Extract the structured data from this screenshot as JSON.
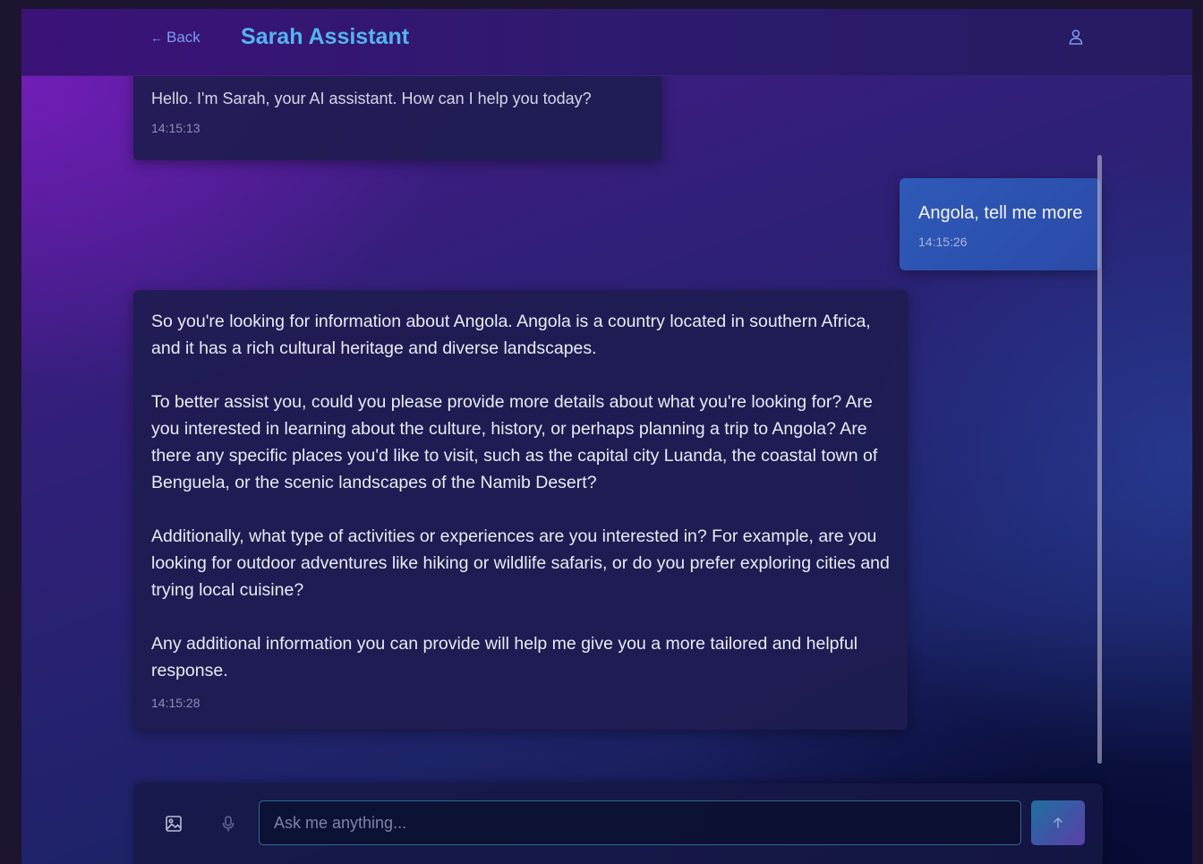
{
  "header": {
    "back_label": "Back",
    "back_arrow": "←",
    "title": "Sarah Assistant",
    "user_icon": "user-icon"
  },
  "messages": [
    {
      "role": "assistant",
      "text": "Hello. I'm Sarah, your AI assistant. How can I help you today?",
      "time": "14:15:13"
    },
    {
      "role": "user",
      "text": "Angola, tell me more",
      "time": "14:15:26"
    },
    {
      "role": "assistant",
      "paragraphs": [
        "So you're looking for information about Angola. Angola is a country located in southern Africa, and it has a rich cultural heritage and diverse landscapes.",
        "To better assist you, could you please provide more details about what you're looking for? Are you interested in learning about the culture, history, or perhaps planning a trip to Angola? Are there any specific places you'd like to visit, such as the capital city Luanda, the coastal town of Benguela, or the scenic landscapes of the Namib Desert?",
        "Additionally, what type of activities or experiences are you interested in? For example, are you looking for outdoor adventures like hiking or wildlife safaris, or do you prefer exploring cities and trying local cuisine?",
        "Any additional information you can provide will help me give you a more tailored and helpful response."
      ],
      "time": "14:15:28"
    }
  ],
  "input": {
    "placeholder": "Ask me anything...",
    "value": "",
    "image_icon": "image-icon",
    "mic_icon": "microphone-icon",
    "send_icon": "arrow-up-icon"
  },
  "colors": {
    "title": "#54b4f0",
    "back_link": "#7a9cf0",
    "user_bubble": "#2e5ab8",
    "assistant_bubble": "#1e1c50"
  }
}
